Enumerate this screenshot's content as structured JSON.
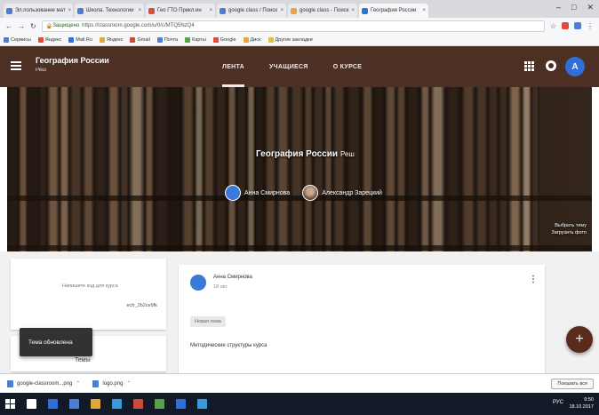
{
  "browser": {
    "tabs": [
      {
        "label": "Эл.пользование мат",
        "color": "#4a7fd4"
      },
      {
        "label": "Школа. Технологии",
        "color": "#4a7fd4"
      },
      {
        "label": "Гео ГТО Прикл.ин",
        "color": "#e04a3a"
      },
      {
        "label": "google class / Поиск",
        "color": "#4a7fd4"
      },
      {
        "label": "google class - Поиск",
        "color": "#e0a83a"
      },
      {
        "label": "География России",
        "color": "#2f6fd6",
        "active": true
      }
    ],
    "url_secure": "Защищено",
    "url_rest": "https://classroom.google.com/u/0/c/MTQ5NzQ4",
    "bookmarks": [
      {
        "label": "Сервисы",
        "color": "#4a7fd4"
      },
      {
        "label": "Яндекс",
        "color": "#e04a3a"
      },
      {
        "label": "Mail.Ru",
        "color": "#2f6fd6"
      },
      {
        "label": "Яндекс",
        "color": "#e0a83a"
      },
      {
        "label": "Gmail",
        "color": "#d04a3a"
      },
      {
        "label": "Почта",
        "color": "#4a7fd4"
      },
      {
        "label": "Карты",
        "color": "#5aa04a"
      },
      {
        "label": "Google",
        "color": "#e04a3a"
      },
      {
        "label": "Диск",
        "color": "#e0a83a"
      },
      {
        "label": "Другие закладки",
        "color": "#e0c040"
      }
    ]
  },
  "app": {
    "course_title": "География России",
    "course_subtitle": "Реш",
    "nav": [
      "ЛЕНТА",
      "УЧАЩИЕСЯ",
      "О КУРСЕ"
    ],
    "avatar_letter": "А"
  },
  "banner": {
    "title": "География России",
    "subtitle": "Реш",
    "teachers": [
      "Анна Смирнова",
      "Александр Зарецкий"
    ],
    "links": [
      "Выбрать тему",
      "Загрузить фото"
    ]
  },
  "sidebar": {
    "info_line1": "Напишите код для курса",
    "info_line2": "ecfr_2b2ce9fk",
    "tasks_label": "Темы",
    "snackbar": "Тема обновлена"
  },
  "post": {
    "author": "Анна Смирнова",
    "date": "18 окт.",
    "chip": "Новая тема",
    "text": "Методические структуры курса"
  },
  "fab": "+",
  "downloads": {
    "items": [
      "google-classroom...png",
      "logo.png"
    ],
    "show_all": "Показать все"
  },
  "taskbar": {
    "time": "9:50",
    "date": "18.10.2017",
    "tray_lang": "РУС",
    "icon_colors": [
      "#ffffff",
      "#2f6fd6",
      "#4a7fd4",
      "#e0a83a",
      "#3a9ad9",
      "#d04a3a",
      "#5aa04a",
      "#2f6fd6",
      "#3a9ad9"
    ]
  }
}
